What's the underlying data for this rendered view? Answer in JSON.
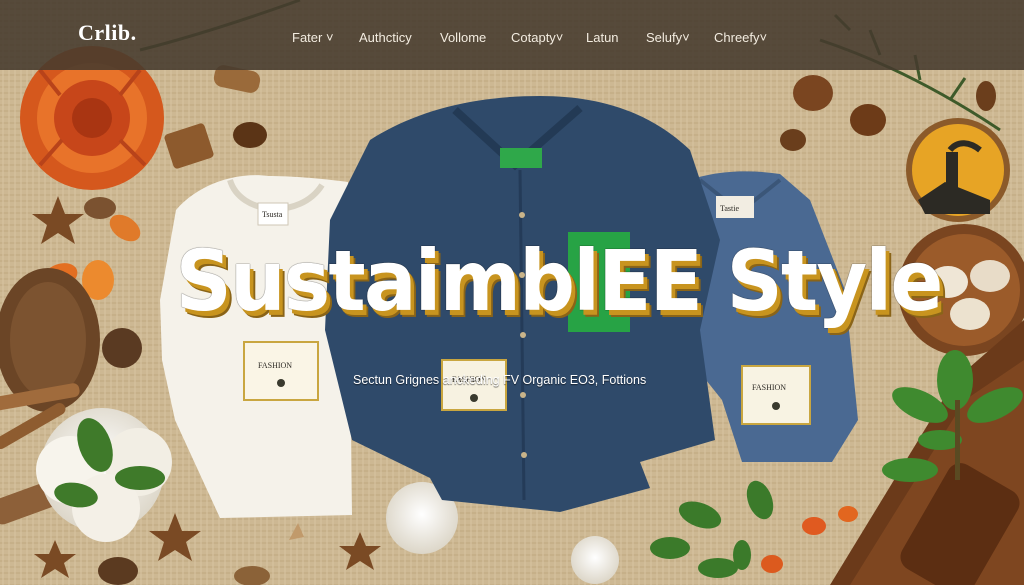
{
  "site": {
    "logo": "Crlib."
  },
  "nav": {
    "items": [
      {
        "label": "Fater ˅"
      },
      {
        "label": "Authcticy"
      },
      {
        "label": "Vollome"
      },
      {
        "label": "Cotapty˅"
      },
      {
        "label": "Latun"
      },
      {
        "label": "Selufy˅"
      },
      {
        "label": "Chreefy˅"
      }
    ]
  },
  "hero": {
    "headline": "SustaimblEE Style",
    "subline": "Sectun Grignes anckeding FV Organic EO3, Fottions"
  },
  "labels": {
    "tshirt_neck_tag": "Tsusta",
    "tshirt_tag": "FASHION",
    "denim_shirt_tag": "FASHION",
    "small_shirt_neck_tag": "Tastie",
    "small_shirt_tag": "FASHION"
  },
  "colors": {
    "navbar_bg": "#463a2d",
    "headline_fill": "#ffffff",
    "headline_shadow": "#c8941f",
    "background": "#cdb893"
  }
}
